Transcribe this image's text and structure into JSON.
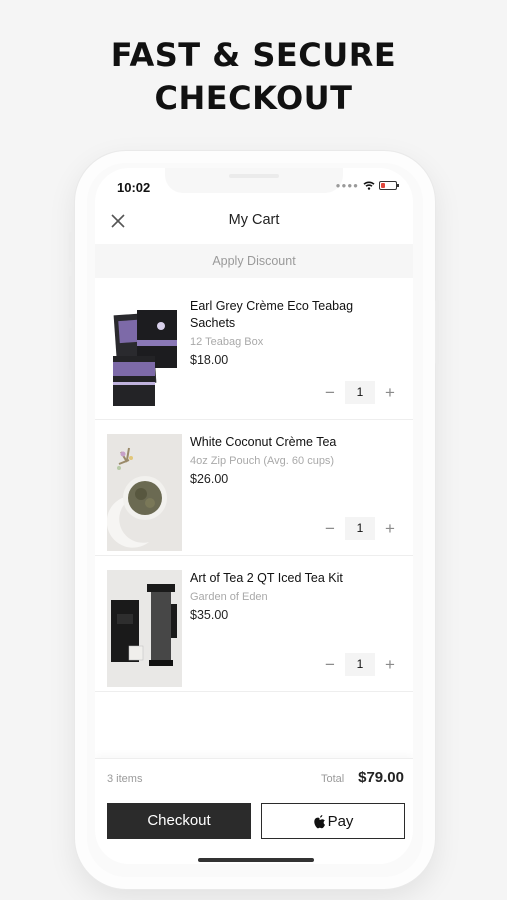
{
  "headline": [
    "FAST & SECURE",
    "CHECKOUT"
  ],
  "status_bar": {
    "time": "10:02"
  },
  "nav": {
    "title": "My Cart",
    "close_icon": "close-icon"
  },
  "discount": {
    "label": "Apply Discount"
  },
  "cart": {
    "items": [
      {
        "name": "Earl Grey Crème Eco Teabag Sachets",
        "variant": "12 Teabag Box",
        "price": "$18.00",
        "quantity": "1"
      },
      {
        "name": "White Coconut Crème Tea",
        "variant": "4oz Zip Pouch (Avg. 60 cups)",
        "price": "$26.00",
        "quantity": "1"
      },
      {
        "name": "Art of Tea 2 QT Iced Tea Kit",
        "variant": "Garden of Eden",
        "price": "$35.00",
        "quantity": "1"
      }
    ],
    "minus": "−",
    "plus": "+"
  },
  "footer": {
    "items_count": "3 items",
    "total_label": "Total",
    "total_value": "$79.00",
    "checkout_label": "Checkout",
    "applepay_label": "Pay"
  },
  "colors": {
    "dark_button": "#2b2b2b",
    "muted_text": "#9a9a9a",
    "background": "#f5f5f5"
  }
}
